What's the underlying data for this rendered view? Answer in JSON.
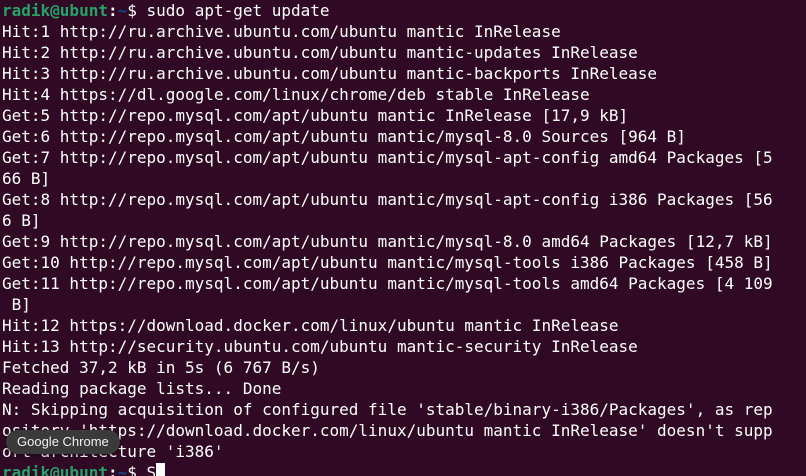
{
  "prompt": {
    "user_host": "radik@ubunt",
    "colon": ":",
    "path": "~",
    "symbol": "$"
  },
  "command": " sudo apt-get update",
  "output_lines": [
    "Hit:1 http://ru.archive.ubuntu.com/ubuntu mantic InRelease",
    "Hit:2 http://ru.archive.ubuntu.com/ubuntu mantic-updates InRelease",
    "Hit:3 http://ru.archive.ubuntu.com/ubuntu mantic-backports InRelease",
    "Hit:4 https://dl.google.com/linux/chrome/deb stable InRelease",
    "Get:5 http://repo.mysql.com/apt/ubuntu mantic InRelease [17,9 kB]",
    "Get:6 http://repo.mysql.com/apt/ubuntu mantic/mysql-8.0 Sources [964 B]",
    "Get:7 http://repo.mysql.com/apt/ubuntu mantic/mysql-apt-config amd64 Packages [5",
    "66 B]",
    "Get:8 http://repo.mysql.com/apt/ubuntu mantic/mysql-apt-config i386 Packages [56",
    "6 B]",
    "Get:9 http://repo.mysql.com/apt/ubuntu mantic/mysql-8.0 amd64 Packages [12,7 kB]",
    "Get:10 http://repo.mysql.com/apt/ubuntu mantic/mysql-tools i386 Packages [458 B]",
    "Get:11 http://repo.mysql.com/apt/ubuntu mantic/mysql-tools amd64 Packages [4 109",
    " B]",
    "Hit:12 https://download.docker.com/linux/ubuntu mantic InRelease",
    "Hit:13 http://security.ubuntu.com/ubuntu mantic-security InRelease",
    "Fetched 37,2 kB in 5s (6 767 B/s)",
    "Reading package lists... Done",
    "N: Skipping acquisition of configured file 'stable/binary-i386/Packages', as rep",
    "ository 'https://download.docker.com/linux/ubuntu mantic InRelease' doesn't supp",
    "ort architecture 'i386'"
  ],
  "final_prompt_input": " S",
  "tooltip": "Google Chrome",
  "colors": {
    "background": "#300a24",
    "prompt_user": "#26a269",
    "prompt_path": "#12488b",
    "text": "#ffffff"
  }
}
